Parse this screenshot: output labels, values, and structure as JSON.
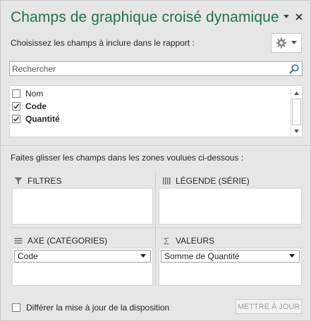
{
  "header": {
    "title": "Champs de graphique croisé dynamique",
    "menu_icon": "chevron-down-icon",
    "close_icon": "close-icon"
  },
  "chooser": {
    "subtitle": "Choisissez les champs à inclure dans le rapport :",
    "tools_icon": "gear-icon"
  },
  "search": {
    "placeholder": "Rechercher",
    "value": ""
  },
  "fields": [
    {
      "label": "Nom",
      "checked": false
    },
    {
      "label": "Code",
      "checked": true
    },
    {
      "label": "Quantité",
      "checked": true
    }
  ],
  "areas": {
    "hint": "Faites glisser les champs dans les zones voulues ci-dessous :",
    "filters": {
      "label": "FILTRES",
      "icon": "filter-icon"
    },
    "legend": {
      "label": "LÉGENDE (SÉRIE)",
      "icon": "columns-icon",
      "item": null
    },
    "axis": {
      "label": "AXE (CATÉGORIES)",
      "icon": "rows-icon",
      "item": "Code"
    },
    "values": {
      "label": "VALEURS",
      "icon": "sigma-icon",
      "item": "Somme de Quantité"
    }
  },
  "footer": {
    "defer_label": "Différer la mise à jour de la disposition",
    "defer_checked": false,
    "update_label": "METTRE À JOUR"
  },
  "colors": {
    "accent": "#217346",
    "background": "#e6e6e6"
  }
}
